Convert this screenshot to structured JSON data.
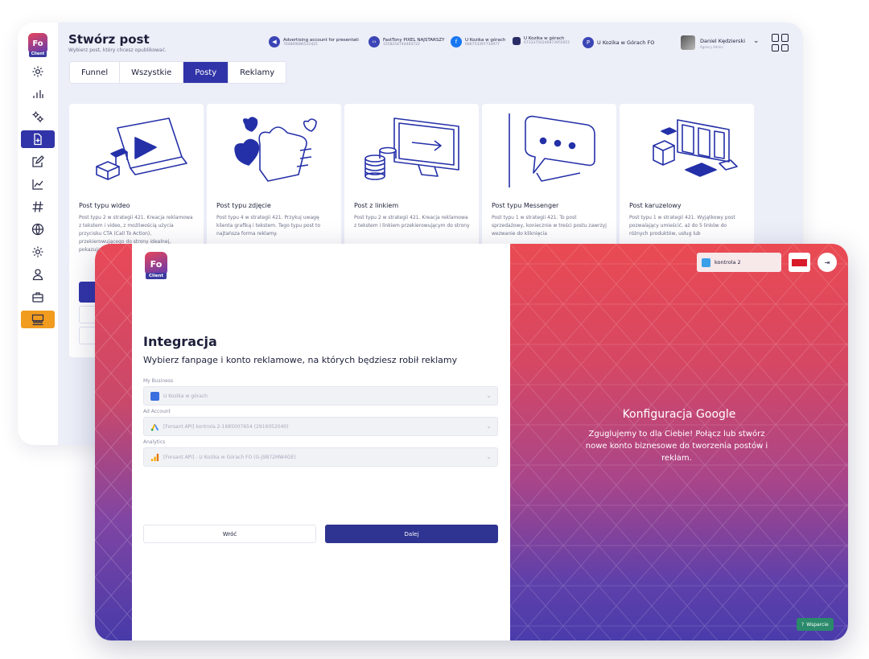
{
  "app": {
    "logo_text": "Fo",
    "logo_sub": "Client"
  },
  "back": {
    "title": "Stwórz post",
    "subtitle": "Wybierz post, który chcesz opublikować.",
    "accounts": [
      {
        "name": "Advertising account for presentati",
        "id": "764809086531421",
        "icon": "megaphone-icon"
      },
      {
        "name": "FastTony PIXEL NAJSTARSZY",
        "id": "1558254744404722",
        "icon": "code-icon"
      },
      {
        "name": "U Kozika w górach",
        "id": "686753397734977",
        "icon": "facebook-icon"
      },
      {
        "name": "U Kozika w górach",
        "id": "67333750246873955651",
        "icon": "business-icon"
      },
      {
        "name": "U Kozika w Górach FO",
        "icon": "pinterest-icon"
      }
    ],
    "user": {
      "name": "Daniel Kędzierski",
      "role": "Agency Admin"
    },
    "tabs": [
      "Funnel",
      "Wszystkie",
      "Posty",
      "Reklamy"
    ],
    "active_tab": "Posty",
    "cards": [
      {
        "title": "Post typu wideo",
        "desc": "Post typu 2 w strategii 421. Kreacja reklamowa z tekstem i video, z możliwością użycia przycisku CTA (Call To Action), przekierowującego do strony idealnej, pokazującej..."
      },
      {
        "title": "Post typu zdjęcie",
        "desc": "Post typu 4 w strategii 421. Przykuj uwagę klienta grafiką i tekstem. Tego typu post to najtańsza forma reklamy."
      },
      {
        "title": "Post z linkiem",
        "desc": "Post typu 2 w strategii 421. Kreacja reklamowa z tekstem i linkiem przekierowującym do strony"
      },
      {
        "title": "Post typu Messenger",
        "desc": "Post typu 1 w strategii 421. To post sprzedażowy, koniecznie w treści postu zawrzyj wezwanie do kliknięcia"
      },
      {
        "title": "Post karuzelowy",
        "desc": "Post typu 1 w strategii 421. Wyjątkowy post pozwalający umieścić, aż do 5 linków do różnych produktów, usług lub"
      }
    ]
  },
  "front": {
    "title": "Integracja",
    "subtitle": "Wybierz fanpage i konto reklamowe, na których będziesz robił reklamy",
    "fields": [
      {
        "label": "My Business",
        "value": "U Kozika w górach",
        "icon": "business-icon"
      },
      {
        "label": "Ad Account",
        "value": "[Forsant API] kontrola 2-1685007654 (2916052040)",
        "icon": "google-ads-icon"
      },
      {
        "label": "Analytics",
        "value": "[Forsant API] - U Kozika w Górach FO (G-J9B72MW4GE)",
        "icon": "analytics-icon"
      }
    ],
    "back_label": "Wróć",
    "next_label": "Dalej",
    "account_chip": "kontrola 2",
    "google_title": "Konfiguracja Google",
    "google_desc": "Zguglujemy to dla Ciebie! Połącz lub stwórz nowe konto biznesowe do tworzenia postów i reklam.",
    "support_label": "Wsparcie"
  },
  "colors": {
    "primary": "#3134a8",
    "accent_orange": "#f19b1f",
    "gradient_top": "#ea4a52",
    "gradient_bottom": "#4a3cab"
  }
}
